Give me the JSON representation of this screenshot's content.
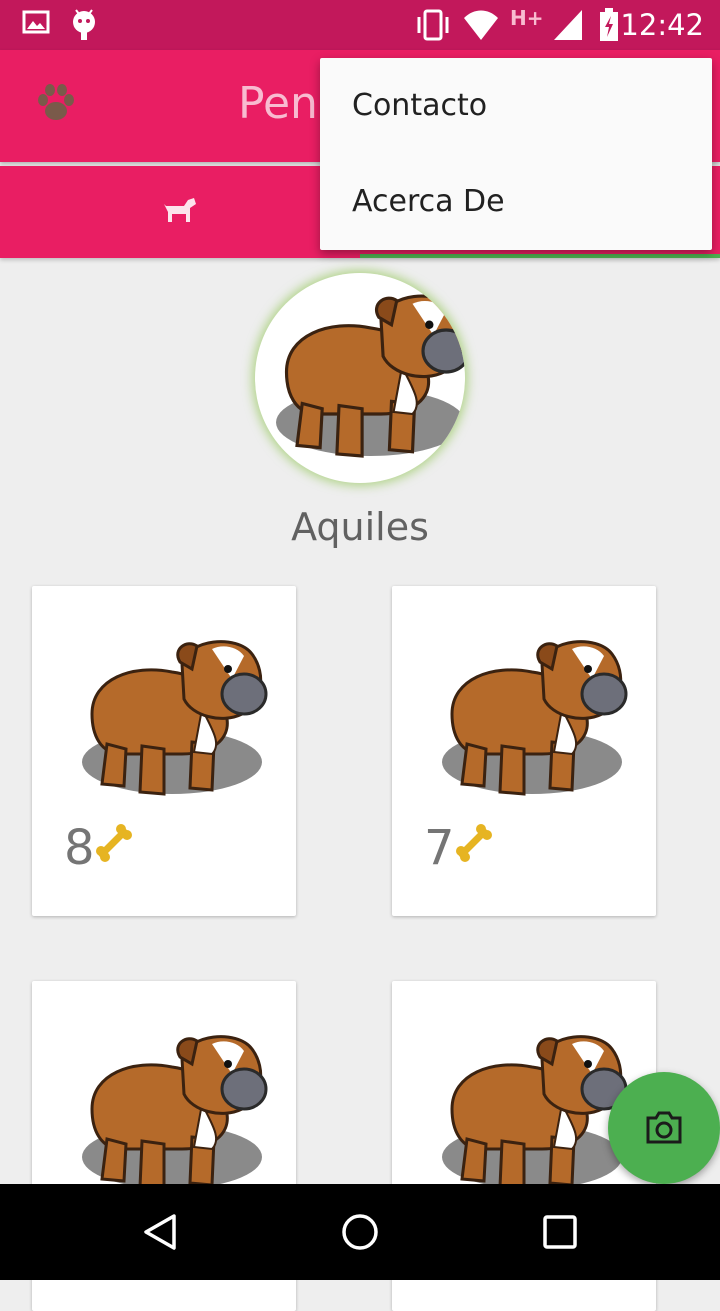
{
  "status_bar": {
    "time": "12:42",
    "network": "H+",
    "icons": [
      "gallery-icon",
      "android-icon",
      "vibrate-icon",
      "wifi-icon",
      "signal-icon",
      "battery-charging-icon"
    ]
  },
  "toolbar": {
    "title": "Pen",
    "logo_icon": "paw-icon"
  },
  "tabs": {
    "items": [
      {
        "icon": "dog-icon"
      }
    ]
  },
  "overflow_menu": {
    "items": [
      {
        "label": "Contacto"
      },
      {
        "label": "Acerca De"
      }
    ]
  },
  "profile": {
    "name": "Aquiles"
  },
  "grid": {
    "cards": [
      {
        "likes": "8",
        "icon": "bone-icon"
      },
      {
        "likes": "7",
        "icon": "bone-icon"
      },
      {
        "likes": "",
        "icon": ""
      },
      {
        "likes": "",
        "icon": ""
      }
    ]
  },
  "fab": {
    "icon": "camera-icon"
  },
  "nav_bar": {
    "buttons": [
      "back-icon",
      "home-icon",
      "recents-icon"
    ]
  },
  "colors": {
    "primary": "#e91e63",
    "primary_dark": "#c2185b",
    "accent": "#4caf50"
  }
}
